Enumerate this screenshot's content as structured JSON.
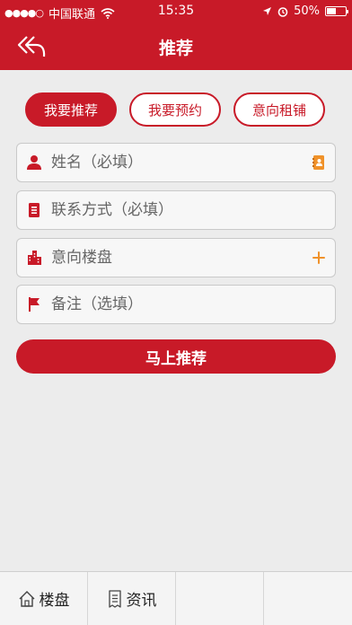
{
  "status_bar": {
    "carrier": "中国联通",
    "time": "15:35",
    "battery": "50%",
    "battery_level": 0.5,
    "icons": [
      "signal-dots-icon",
      "wifi-icon",
      "location-arrow-icon",
      "alarm-icon",
      "battery-icon"
    ]
  },
  "nav": {
    "title": "推荐",
    "back_icon": "back-arrow-icon"
  },
  "tabs": [
    {
      "label": "我要推荐",
      "active": true
    },
    {
      "label": "我要预约",
      "active": false
    },
    {
      "label": "意向租铺",
      "active": false
    }
  ],
  "form": {
    "name_placeholder": "姓名（必填）",
    "contact_placeholder": "联系方式（必填）",
    "property_placeholder": "意向楼盘",
    "remark_placeholder": "备注（选填）",
    "icons": {
      "name": "person-icon",
      "contact": "document-icon",
      "property": "building-icon",
      "remark": "flag-icon",
      "contacts_book": "address-book-icon",
      "add": "plus-icon"
    }
  },
  "submit_label": "马上推荐",
  "tab_bar": {
    "items": [
      {
        "label": "楼盘",
        "icon": "house-icon"
      },
      {
        "label": "资讯",
        "icon": "news-icon"
      },
      {
        "label": "",
        "icon": ""
      },
      {
        "label": "",
        "icon": ""
      }
    ]
  },
  "colors": {
    "brand_red": "#c81a28",
    "accent_orange": "#f0922a",
    "background": "#ececec"
  }
}
